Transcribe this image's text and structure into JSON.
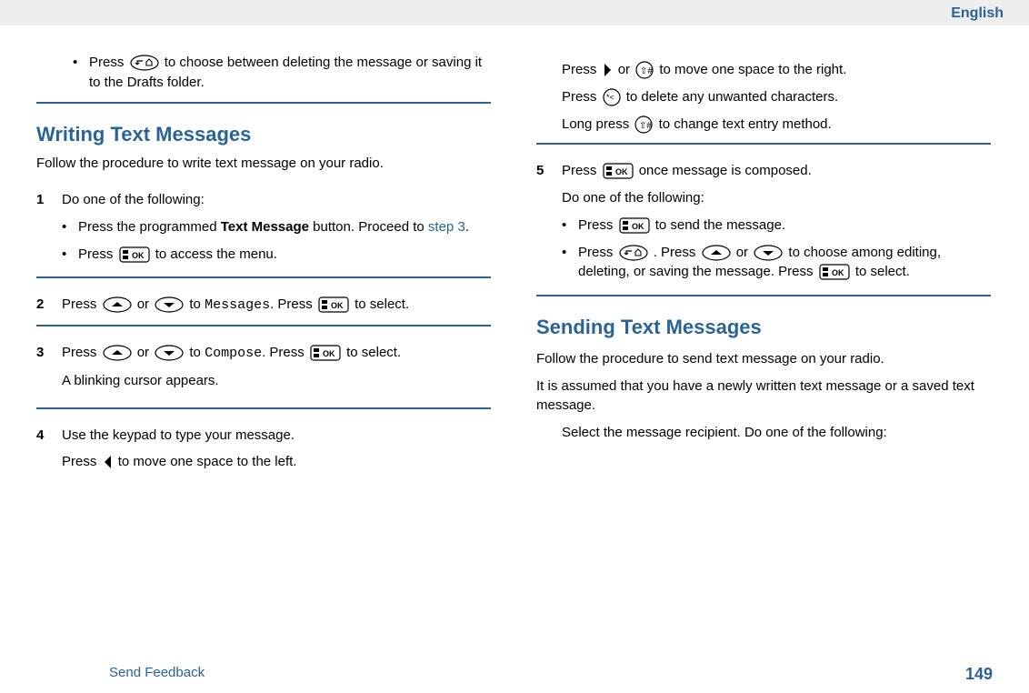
{
  "header": {
    "language": "English"
  },
  "left": {
    "intro_bullet": {
      "pre": "Press ",
      "post": " to choose between deleting the message or saving it to the Drafts folder."
    },
    "section_title": "Writing Text Messages",
    "section_intro": "Follow the procedure to write text message on your radio.",
    "step1": {
      "num": "1",
      "text": "Do one of the following:",
      "b1_pre": "Press the programmed ",
      "b1_bold": "Text Message",
      "b1_post": " button. Proceed to ",
      "b1_link": "step 3",
      "b1_end": ".",
      "b2_pre": "Press ",
      "b2_post": " to access the menu."
    },
    "step2": {
      "num": "2",
      "t1": "Press ",
      "t2": " or ",
      "t3": " to ",
      "mono": "Messages",
      "t4": ". Press ",
      "t5": " to select."
    },
    "step3": {
      "num": "3",
      "t1": "Press ",
      "t2": " or ",
      "t3": " to ",
      "mono": "Compose",
      "t4": ". Press ",
      "t5": " to select.",
      "extra": "A blinking cursor appears."
    },
    "step4": {
      "num": "4",
      "text": "Use the keypad to type your message.",
      "p1_pre": "Press ",
      "p1_post": " to move one space to the left."
    }
  },
  "right": {
    "r1_pre": "Press ",
    "r1_mid": " or ",
    "r1_post": " to move one space to the right.",
    "r2_pre": "Press ",
    "r2_post": " to delete any unwanted characters.",
    "r3_pre": "Long press ",
    "r3_post": " to change text entry method.",
    "step5": {
      "num": "5",
      "t1": "Press ",
      "t2": " once message is composed.",
      "t3": "Do one of the following:",
      "b1_pre": "Press ",
      "b1_post": " to send the message.",
      "b2_p1": "Press ",
      "b2_p2": " . Press ",
      "b2_p3": " or ",
      "b2_p4": " to choose among editing, deleting, or saving the message. Press ",
      "b2_p5": " to select."
    },
    "section2_title": "Sending Text Messages",
    "section2_intro": "Follow the procedure to send text message on your radio.",
    "section2_note": "It is assumed that you have a newly written text message or a saved text message.",
    "section2_body": "Select the message recipient. Do one of the following:"
  },
  "footer": {
    "feedback": "Send Feedback",
    "page": "149"
  }
}
